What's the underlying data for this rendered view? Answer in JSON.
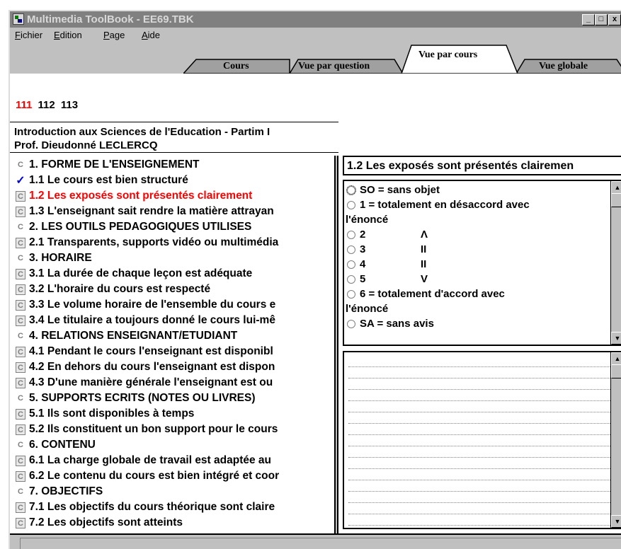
{
  "window": {
    "title": "Multimedia ToolBook - EE69.TBK",
    "controls": {
      "minimize": "_",
      "maximize": "□",
      "close": "x"
    }
  },
  "menu": {
    "items": [
      {
        "label": "Fichier",
        "accel": "F",
        "rest": "ichier"
      },
      {
        "label": "Edition",
        "accel": "E",
        "rest": "dition"
      },
      {
        "label": "Page",
        "accel": "P",
        "rest": "age"
      },
      {
        "label": "Aide",
        "accel": "A",
        "rest": "ide"
      }
    ]
  },
  "tabs": [
    {
      "label": "Cours",
      "active": false
    },
    {
      "label": "Vue par question",
      "active": false
    },
    {
      "label": "Vue par cours",
      "active": true
    },
    {
      "label": "Vue globale",
      "active": false
    }
  ],
  "pages": {
    "items": [
      {
        "label": "111",
        "color": "#ff0000"
      },
      {
        "label": "112",
        "color": "#000000"
      },
      {
        "label": "113",
        "color": "#000000"
      }
    ]
  },
  "course": {
    "name": "Introduction aux Sciences de l'Education - Partim I",
    "professor": "Prof. Dieudonné LECLERCQ"
  },
  "questions": [
    {
      "text": "1. FORME DE L'ENSEIGNEMENT",
      "marker": "C",
      "style": "plain",
      "color": "#000000"
    },
    {
      "text": "1.1 Le cours est bien structuré",
      "marker": "✓",
      "style": "checked",
      "color": "#000000"
    },
    {
      "text": "1.2 Les exposés sont présentés clairement",
      "marker": "C",
      "style": "boxed",
      "color": "#ff0000"
    },
    {
      "text": "1.3 L'enseignant sait rendre la matière attrayan",
      "marker": "C",
      "style": "boxed",
      "color": "#000000"
    },
    {
      "text": "2. LES OUTILS PEDAGOGIQUES UTILISES",
      "marker": "C",
      "style": "plain",
      "color": "#000000"
    },
    {
      "text": "2.1 Transparents, supports vidéo ou multimédia",
      "marker": "C",
      "style": "boxed",
      "color": "#000000"
    },
    {
      "text": "3. HORAIRE",
      "marker": "C",
      "style": "plain",
      "color": "#000000"
    },
    {
      "text": "3.1 La durée de chaque leçon est adéquate",
      "marker": "C",
      "style": "boxed",
      "color": "#000000"
    },
    {
      "text": "3.2 L'horaire du cours est respecté",
      "marker": "C",
      "style": "boxed",
      "color": "#000000"
    },
    {
      "text": "3.3 Le volume horaire de l'ensemble du cours e",
      "marker": "C",
      "style": "boxed",
      "color": "#000000"
    },
    {
      "text": "3.4 Le titulaire a toujours donné le cours lui-mê",
      "marker": "C",
      "style": "boxed",
      "color": "#000000"
    },
    {
      "text": "4. RELATIONS ENSEIGNANT/ETUDIANT",
      "marker": "C",
      "style": "plain",
      "color": "#000000"
    },
    {
      "text": "4.1 Pendant le cours l'enseignant est disponibl",
      "marker": "C",
      "style": "boxed",
      "color": "#000000"
    },
    {
      "text": "4.2 En dehors du cours l'enseignant est dispon",
      "marker": "C",
      "style": "boxed",
      "color": "#000000"
    },
    {
      "text": "4.3 D'une manière générale l'enseignant est ou",
      "marker": "C",
      "style": "boxed",
      "color": "#000000"
    },
    {
      "text": "5. SUPPORTS ECRITS (NOTES OU LIVRES)",
      "marker": "C",
      "style": "plain",
      "color": "#000000"
    },
    {
      "text": "5.1 Ils sont disponibles à temps",
      "marker": "C",
      "style": "boxed",
      "color": "#000000"
    },
    {
      "text": "5.2 Ils constituent un bon support pour le cours",
      "marker": "C",
      "style": "boxed",
      "color": "#000000"
    },
    {
      "text": "6. CONTENU",
      "marker": "C",
      "style": "plain",
      "color": "#000000"
    },
    {
      "text": "6.1 La charge globale de travail est adaptée au",
      "marker": "C",
      "style": "boxed",
      "color": "#000000"
    },
    {
      "text": "6.2 Le contenu du cours est bien intégré et coor",
      "marker": "C",
      "style": "boxed",
      "color": "#000000"
    },
    {
      "text": "7. OBJECTIFS",
      "marker": "C",
      "style": "plain",
      "color": "#000000"
    },
    {
      "text": "7.1 Les objectifs du cours théorique sont claire",
      "marker": "C",
      "style": "boxed",
      "color": "#000000"
    },
    {
      "text": "7.2 Les objectifs sont atteints",
      "marker": "C",
      "style": "boxed",
      "color": "#000000"
    }
  ],
  "selected_question": {
    "title": "1.2 Les exposés sont présentés clairemen"
  },
  "answers": [
    {
      "label": "SO = sans objet",
      "radio": true,
      "selected_outline": true
    },
    {
      "label": "1 = totalement en désaccord avec",
      "radio": true
    },
    {
      "label": "l'énoncé",
      "radio": false
    },
    {
      "label": "2",
      "mark": "Λ",
      "radio": true
    },
    {
      "label": "3",
      "mark": "II",
      "radio": true
    },
    {
      "label": "4",
      "mark": "II",
      "radio": true
    },
    {
      "label": "5",
      "mark": "V",
      "radio": true
    },
    {
      "label": "6 = totalement d'accord avec",
      "radio": true
    },
    {
      "label": "l'énoncé",
      "radio": false
    },
    {
      "label": "SA = sans avis",
      "radio": true
    }
  ],
  "scroll": {
    "up_arrow": "▲",
    "down_arrow": "▼"
  },
  "colors": {
    "window_bg": "#c0c0c0",
    "titlebar_inactive": "#808080",
    "highlight_red": "#ff0000",
    "check_blue": "#0000e0"
  }
}
